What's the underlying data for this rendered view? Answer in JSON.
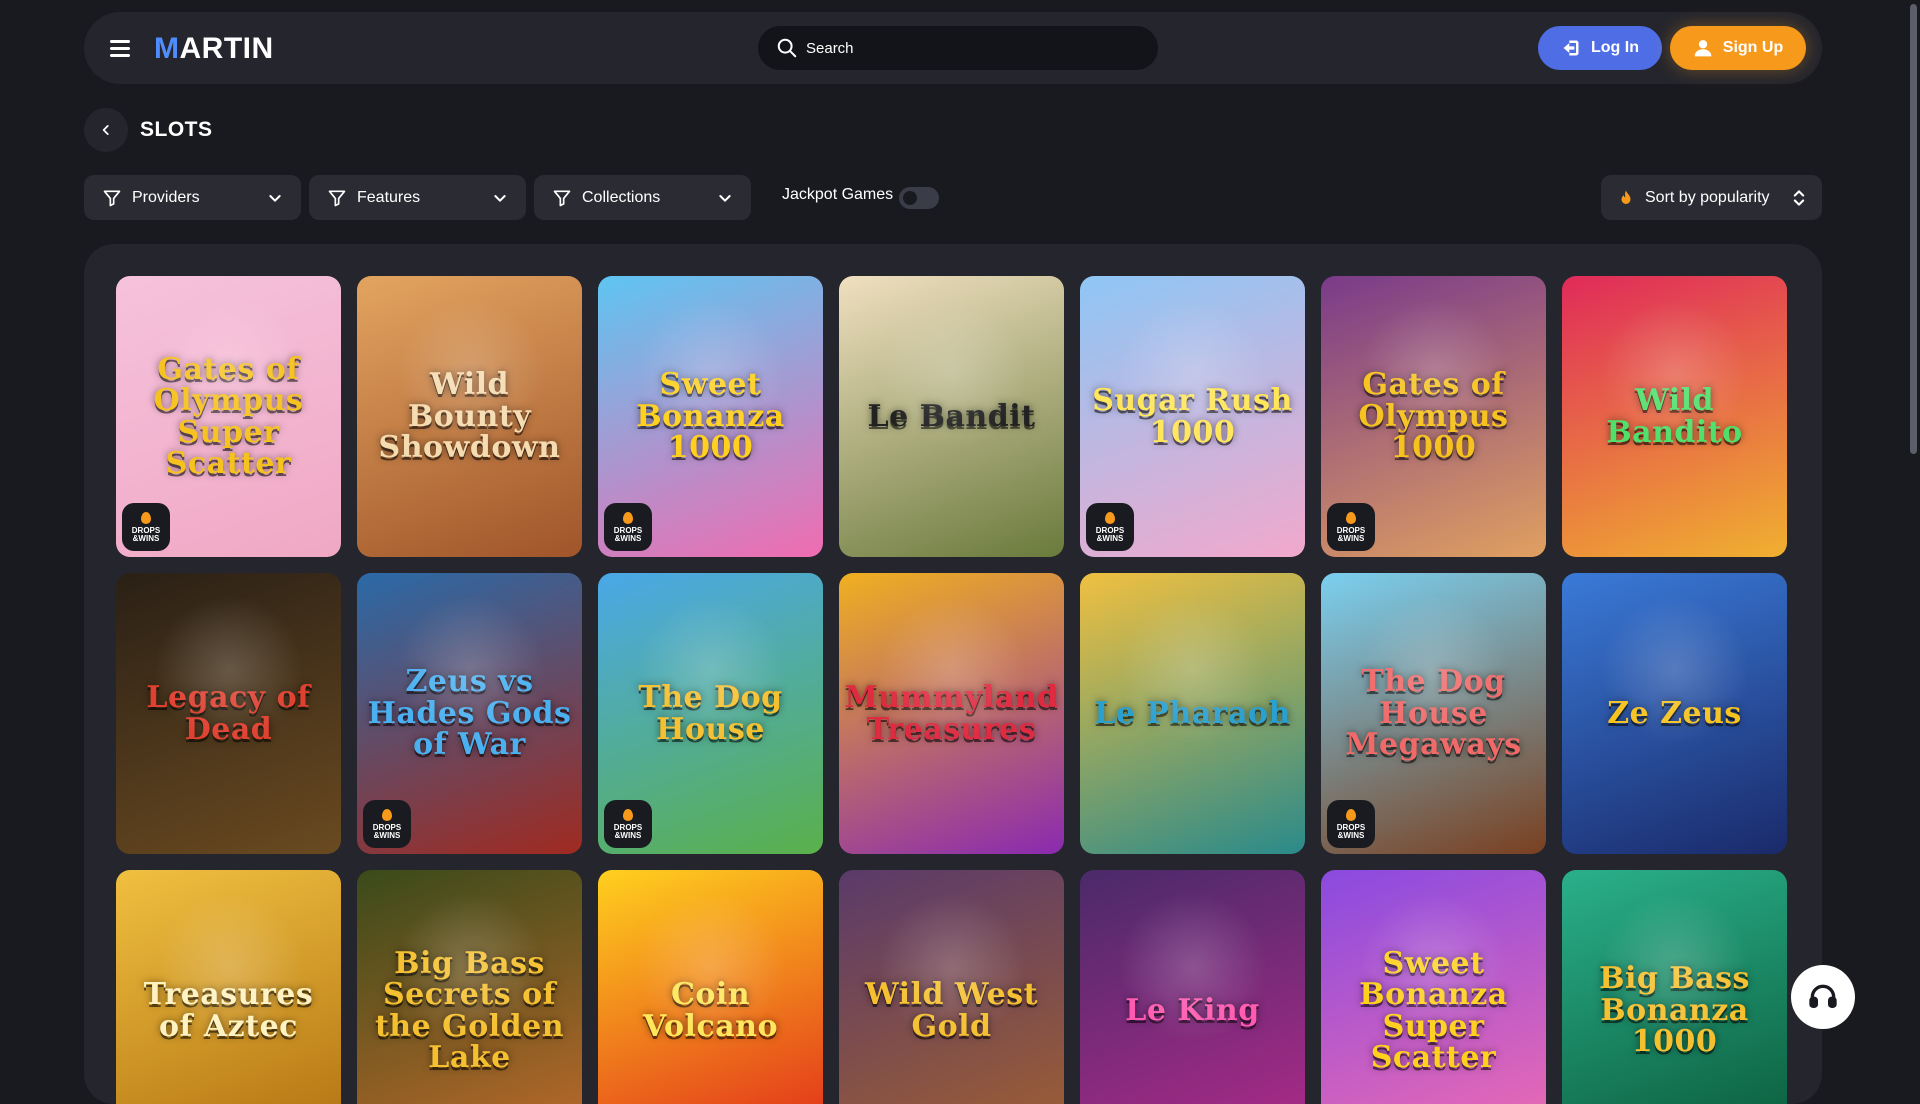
{
  "header": {
    "logo_prefix": "M",
    "logo_rest": "ARTIN",
    "search_placeholder": "Search",
    "login_label": "Log In",
    "signup_label": "Sign Up"
  },
  "page": {
    "title": "SLOTS"
  },
  "filters": {
    "providers": "Providers",
    "features": "Features",
    "collections": "Collections",
    "jackpot_label": "Jackpot Games",
    "jackpot_enabled": false,
    "sort_label": "Sort by popularity"
  },
  "badge_text": {
    "line1": "DROPS",
    "line2": "&WINS"
  },
  "colors": {
    "accent_blue": "#4f6ee6",
    "accent_orange": "#f79a1c",
    "background": "#191a20",
    "panel": "#24252d"
  },
  "games": [
    {
      "title": "Gates of Olympus Super Scatter",
      "drops_wins": true,
      "bg": [
        "#f6c2dc",
        "#f0a8c4"
      ],
      "fg": "#f6c21e"
    },
    {
      "title": "Wild Bounty Showdown",
      "drops_wins": false,
      "bg": [
        "#e3a460",
        "#a0552a"
      ],
      "fg": "#f5dbb0"
    },
    {
      "title": "Sweet Bonanza 1000",
      "drops_wins": true,
      "bg": [
        "#5ec5f2",
        "#f06cb0"
      ],
      "fg": "#ffd01e"
    },
    {
      "title": "Le Bandit",
      "drops_wins": false,
      "bg": [
        "#f0e0c0",
        "#6a7a3c"
      ],
      "fg": "#222222"
    },
    {
      "title": "Sugar Rush 1000",
      "drops_wins": true,
      "bg": [
        "#8ec6f5",
        "#f2a8cc"
      ],
      "fg": "#ffe65a"
    },
    {
      "title": "Gates of Olympus 1000",
      "drops_wins": true,
      "bg": [
        "#7a3a8a",
        "#e0a060"
      ],
      "fg": "#f6c21e"
    },
    {
      "title": "Wild Bandito",
      "drops_wins": false,
      "bg": [
        "#e02a5a",
        "#f0b030"
      ],
      "fg": "#4ee06a"
    },
    {
      "title": "Legacy of Dead",
      "drops_wins": false,
      "bg": [
        "#2a2016",
        "#6a4a20"
      ],
      "fg": "#e04030"
    },
    {
      "title": "Zeus vs Hades Gods of War",
      "drops_wins": true,
      "bg": [
        "#2a6aa8",
        "#a02a20"
      ],
      "fg": "#4ab0f0"
    },
    {
      "title": "The Dog House",
      "drops_wins": true,
      "bg": [
        "#4aa8e8",
        "#5ab04a"
      ],
      "fg": "#f5c030"
    },
    {
      "title": "Mummyland Treasures",
      "drops_wins": false,
      "bg": [
        "#f0b020",
        "#8a2ab0"
      ],
      "fg": "#e02a40"
    },
    {
      "title": "Le Pharaoh",
      "drops_wins": false,
      "bg": [
        "#f0c040",
        "#2a8a8a"
      ],
      "fg": "#2aa0d0"
    },
    {
      "title": "The Dog House Megaways",
      "drops_wins": true,
      "bg": [
        "#7ad0f0",
        "#7a4020"
      ],
      "fg": "#f06a6a"
    },
    {
      "title": "Ze Zeus",
      "drops_wins": false,
      "bg": [
        "#3a7ad8",
        "#1a2a6a"
      ],
      "fg": "#f6c21e"
    },
    {
      "title": "Treasures of Aztec",
      "drops_wins": false,
      "bg": [
        "#f0c040",
        "#b07010"
      ],
      "fg": "#fff2c0"
    },
    {
      "title": "Big Bass Secrets of the Golden Lake",
      "drops_wins": false,
      "bg": [
        "#3a4a1a",
        "#c06a2a"
      ],
      "fg": "#f5c030"
    },
    {
      "title": "Coin Volcano",
      "drops_wins": false,
      "bg": [
        "#ffd01e",
        "#e02a1a"
      ],
      "fg": "#ffe65a"
    },
    {
      "title": "Wild West Gold",
      "drops_wins": false,
      "bg": [
        "#5a3a6a",
        "#a06030"
      ],
      "fg": "#f5c030"
    },
    {
      "title": "Le King",
      "drops_wins": false,
      "bg": [
        "#4a2a6a",
        "#b02a8a"
      ],
      "fg": "#ff5ab0"
    },
    {
      "title": "Sweet Bonanza Super Scatter",
      "drops_wins": false,
      "bg": [
        "#8a4ae0",
        "#f06cb0"
      ],
      "fg": "#ffd01e"
    },
    {
      "title": "Big Bass Bonanza 1000",
      "drops_wins": false,
      "bg": [
        "#2ab08a",
        "#0a5a3a"
      ],
      "fg": "#f5c030"
    }
  ]
}
